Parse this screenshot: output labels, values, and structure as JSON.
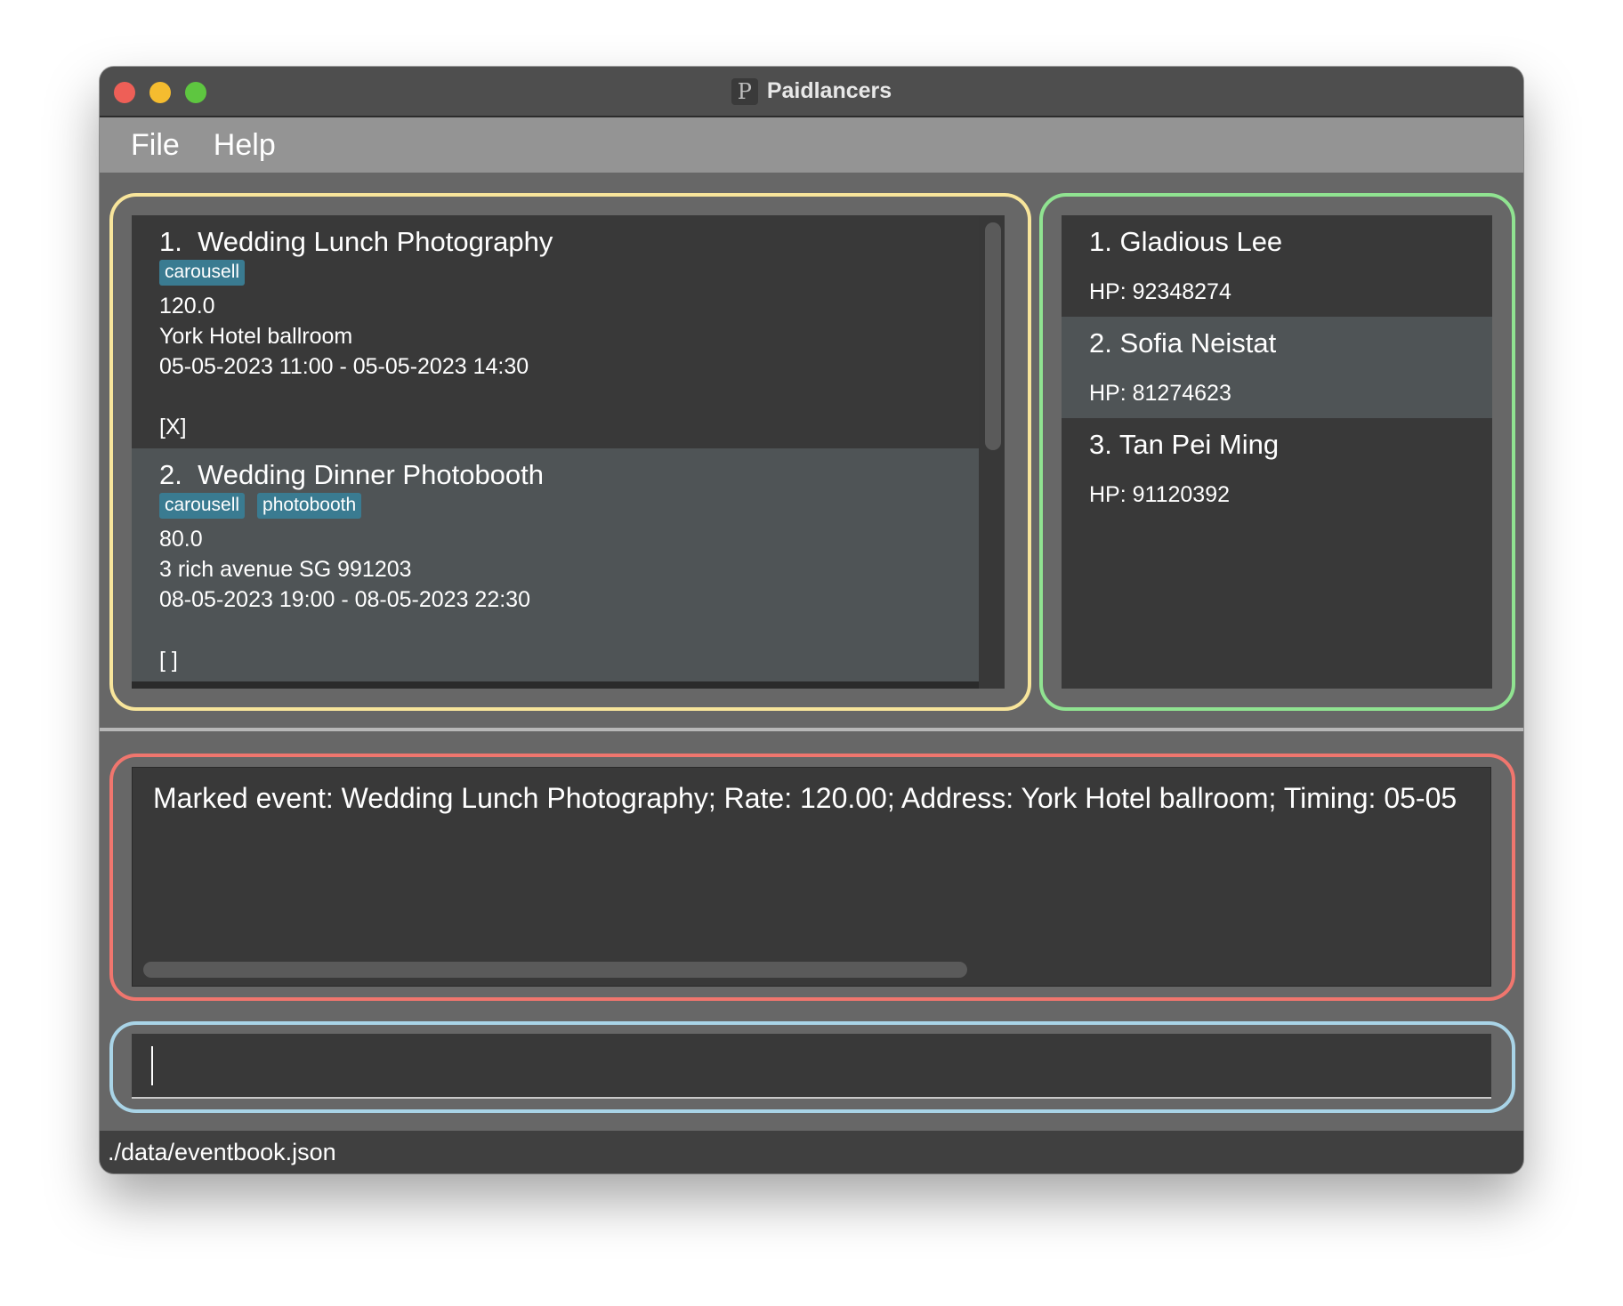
{
  "window": {
    "title": "Paidlancers",
    "icon_glyph": "P"
  },
  "menu": {
    "items": [
      "File",
      "Help"
    ]
  },
  "events": [
    {
      "index": "1.",
      "name": "Wedding Lunch Photography",
      "tags": [
        "carousell"
      ],
      "rate": "120.0",
      "address": "York Hotel ballroom",
      "timing": "05-05-2023 11:00 - 05-05-2023 14:30",
      "mark": "[X]"
    },
    {
      "index": "2.",
      "name": "Wedding Dinner Photobooth",
      "tags": [
        "carousell",
        "photobooth"
      ],
      "rate": "80.0",
      "address": "3 rich avenue SG 991203",
      "timing": "08-05-2023 19:00 - 08-05-2023 22:30",
      "mark": "[ ]"
    }
  ],
  "contacts": [
    {
      "index": "1.",
      "name": "Gladious Lee",
      "phone": "HP: 92348274"
    },
    {
      "index": "2.",
      "name": "Sofia Neistat",
      "phone": "HP: 81274623"
    },
    {
      "index": "3.",
      "name": "Tan Pei Ming",
      "phone": "HP: 91120392"
    }
  ],
  "result": {
    "text": "Marked event: Wedding Lunch Photography; Rate: 120.00; Address: York Hotel ballroom; Timing: 05-05"
  },
  "command": {
    "value": ""
  },
  "status": {
    "path": "./data/eventbook.json"
  },
  "colors": {
    "frame_events": "#f8e59b",
    "frame_contacts": "#90e391",
    "frame_result": "#f0766e",
    "frame_command": "#a9d4e7",
    "tag": "#3a7b91",
    "selected_row": "#4f5456"
  },
  "icons": {
    "close": "close-dot-icon",
    "minimize": "minimize-dot-icon",
    "maximize": "maximize-dot-icon",
    "app": "paidlancers-app-icon"
  }
}
